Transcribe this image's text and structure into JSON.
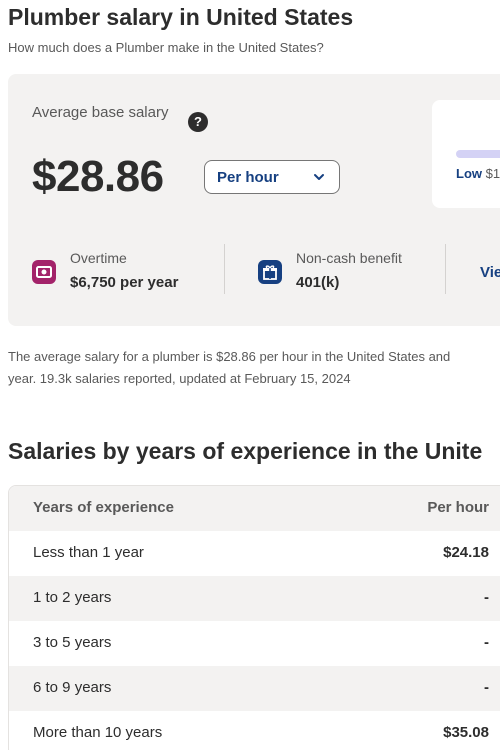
{
  "header": {
    "title": "Plumber salary in United States",
    "subtitle": "How much does a Plumber make in the United States?"
  },
  "salary_card": {
    "average_label": "Average base salary",
    "help_icon_glyph": "?",
    "amount": "$28.86",
    "period": "Per hour",
    "range_low_label": "Low",
    "range_low_value": "$1",
    "benefits": [
      {
        "icon": "money-icon",
        "label": "Overtime",
        "value": "$6,750 per year",
        "color": "#a3236a"
      },
      {
        "icon": "gift-icon",
        "label": "Non-cash benefit",
        "value": "401(k)",
        "color": "#164081"
      }
    ],
    "view_link": "Vie"
  },
  "description": {
    "line1": "The average salary for a plumber is $28.86 per hour in the United States and",
    "line2": "year. 19.3k salaries reported, updated at February 15, 2024"
  },
  "experience": {
    "title": "Salaries by years of experience in the Unite",
    "columns": [
      "Years of experience",
      "Per hour"
    ],
    "rows": [
      {
        "label": "Less than 1 year",
        "value": "$24.18"
      },
      {
        "label": "1 to 2 years",
        "value": "-"
      },
      {
        "label": "3 to 5 years",
        "value": "-"
      },
      {
        "label": "6 to 9 years",
        "value": "-"
      },
      {
        "label": "More than 10 years",
        "value": "$35.08"
      }
    ]
  },
  "colors": {
    "accent": "#164081",
    "text": "#2d2d2d",
    "muted": "#595959",
    "card_bg": "#f3f2f1",
    "range_bar": "#d4d2f5"
  }
}
